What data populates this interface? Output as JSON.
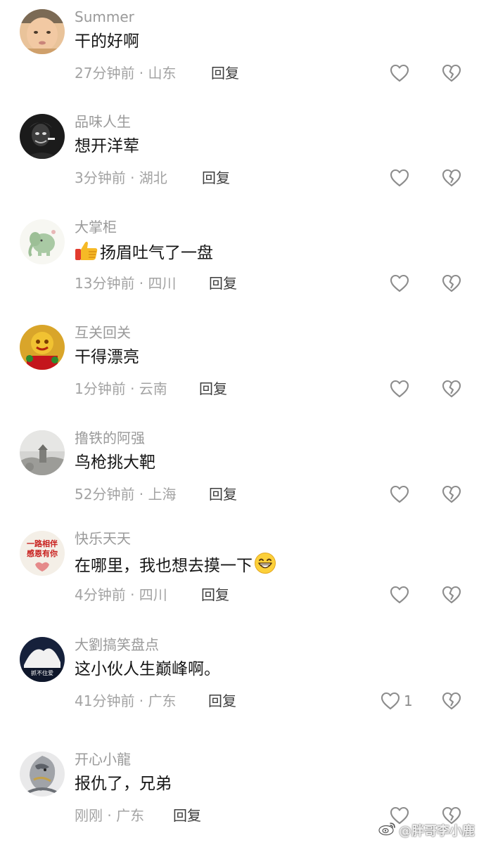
{
  "comments": [
    {
      "username": "Summer",
      "text": "干的好啊",
      "time_location": "27分钟前 · 山东",
      "reply": "回复",
      "like_count": ""
    },
    {
      "username": "品味人生",
      "text": "想开洋荤",
      "time_location": "3分钟前 · 湖北",
      "reply": "回复",
      "like_count": ""
    },
    {
      "username": "大掌柜",
      "text": "扬眉吐气了一盘",
      "time_location": "13分钟前 · 四川",
      "reply": "回复",
      "like_count": "",
      "emoji": "thumbs-up-emoji"
    },
    {
      "username": "互关回关",
      "text": "干得漂亮",
      "time_location": "1分钟前 · 云南",
      "reply": "回复",
      "like_count": ""
    },
    {
      "username": "撸铁的阿强",
      "text": "鸟枪挑大靶",
      "time_location": "52分钟前 · 上海",
      "reply": "回复",
      "like_count": ""
    },
    {
      "username": "快乐天天",
      "text": "在哪里，我也想去摸一下",
      "time_location": "4分钟前 · 四川",
      "reply": "回复",
      "like_count": "",
      "emoji": "grinning-face-emoji",
      "avatar_text": [
        "一路相伴",
        "感恩有你"
      ]
    },
    {
      "username": "大劉搞笑盘点",
      "text": "这小伙人生巅峰啊。",
      "time_location": "41分钟前 · 广东",
      "reply": "回复",
      "like_count": "1",
      "avatar_text": [
        "抓不住爱"
      ]
    },
    {
      "username": "开心小龍",
      "text": "报仇了，兄弟",
      "time_location": "刚刚 · 广东",
      "reply": "回复",
      "like_count": ""
    }
  ],
  "watermark": {
    "text": "@胖哥李小鹿",
    "icon": "weibo-logo-icon"
  },
  "icons": {
    "like": "heart-outline-icon",
    "dislike": "broken-heart-icon"
  }
}
